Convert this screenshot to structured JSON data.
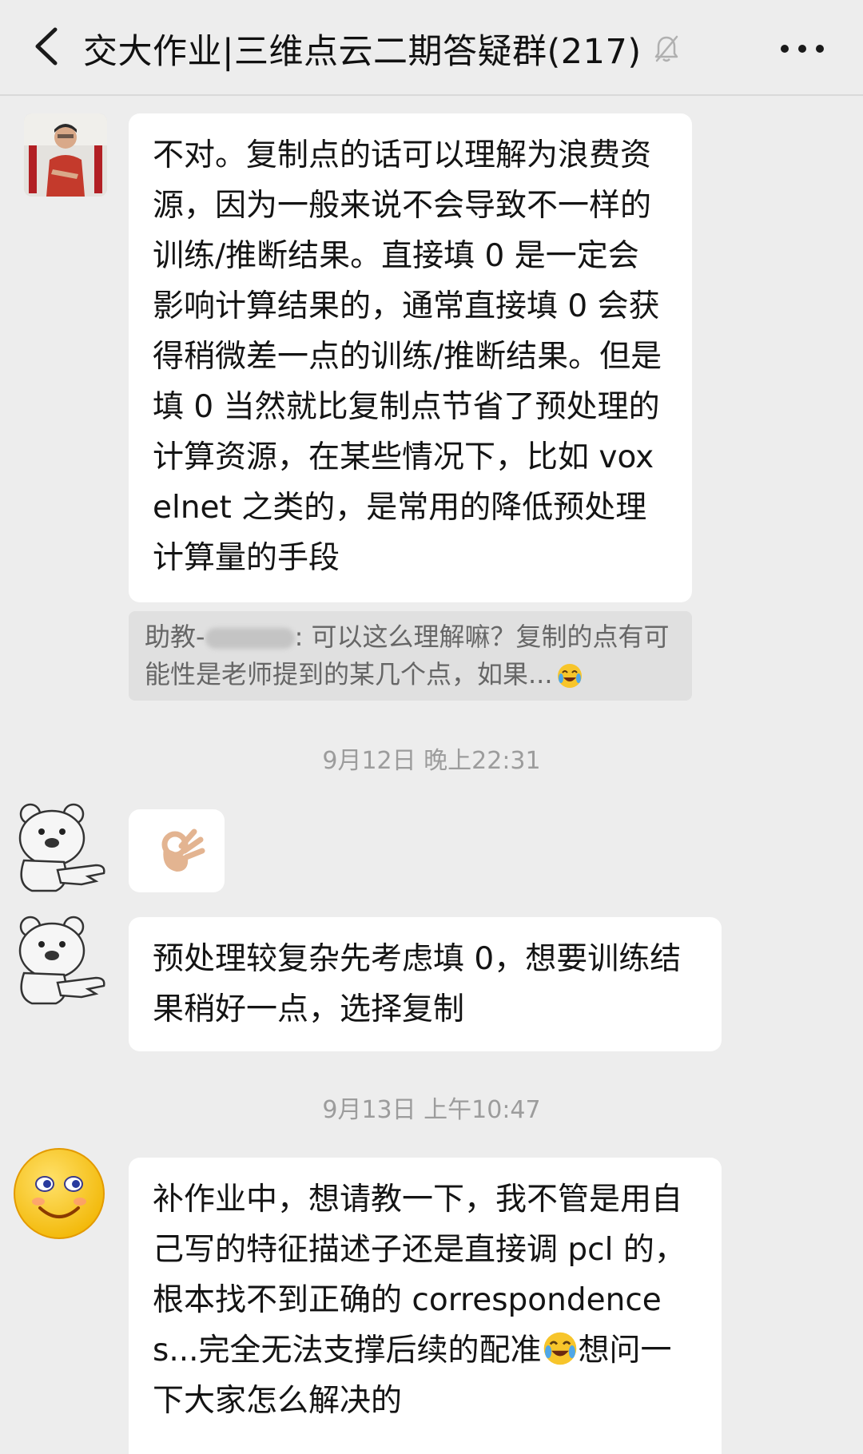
{
  "header": {
    "title": "交大作业|三维点云二期答疑群(217)",
    "back_icon": "chevron-left-icon",
    "mute_icon": "bell-off-icon",
    "more_icon": "more-dots-icon"
  },
  "messages": [
    {
      "avatar": "person-photo",
      "text": "不对。复制点的话可以理解为浪费资源，因为一般来说不会导致不一样的训练/推断结果。直接填 0 是一定会影响计算结果的，通常直接填 0 会获得稍微差一点的训练/推断结果。但是填 0 当然就比复制点节省了预处理的计算资源，在某些情况下，比如 voxelnet 之类的，是常用的降低预处理计算量的手段",
      "quote": {
        "sender_prefix": "助教-",
        "text": ": 可以这么理解嘛？复制的点有可能性是老师提到的某几个点，如果...",
        "emoji": "laughing-crying-emoji"
      }
    },
    {
      "timestamp": "9月12日 晚上22:31"
    },
    {
      "avatar": "bear-pointing-sticker",
      "emoji": "ok-hand-emoji"
    },
    {
      "avatar": "bear-pointing-sticker",
      "text": "预处理较复杂先考虑填 0，想要训练结果稍好一点，选择复制"
    },
    {
      "timestamp": "9月13日 上午10:47"
    },
    {
      "avatar": "smiley-face",
      "text": "补作业中，想请教一下，我不管是用自己写的特征描述子还是直接调 pcl 的，根本找不到正确的 correspondences...完全无法支撑后续的配准",
      "text_after_emoji": "想问一下大家怎么解决的",
      "emoji": "laughing-crying-emoji"
    }
  ],
  "colors": {
    "background": "#ededed",
    "bubble": "#ffffff",
    "quote_bg": "#e0e0e0",
    "timestamp": "#9c9c9c"
  }
}
